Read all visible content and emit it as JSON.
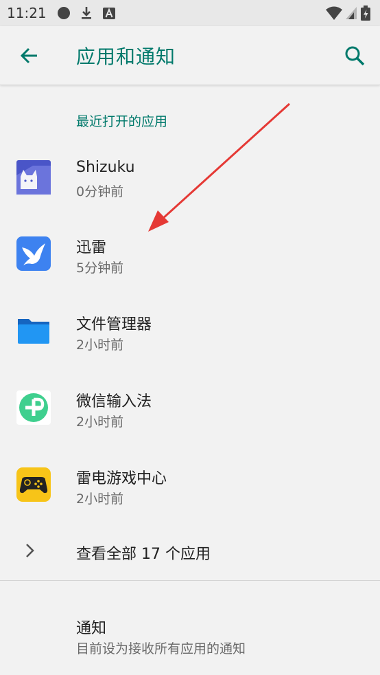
{
  "status_bar": {
    "time": "11:21",
    "icons": [
      "circle-icon",
      "download-icon",
      "font-a-icon",
      "wifi-icon",
      "signal-icon",
      "battery-icon"
    ]
  },
  "app_bar": {
    "title": "应用和通知",
    "back_icon": "arrow-back-icon",
    "search_icon": "search-icon"
  },
  "recent_apps": {
    "header": "最近打开的应用",
    "items": [
      {
        "name": "Shizuku",
        "time": "0分钟前",
        "icon": "shizuku-app-icon"
      },
      {
        "name": "迅雷",
        "time": "5分钟前",
        "icon": "xunlei-app-icon"
      },
      {
        "name": "文件管理器",
        "time": "2小时前",
        "icon": "file-manager-app-icon"
      },
      {
        "name": "微信输入法",
        "time": "2小时前",
        "icon": "wechat-input-app-icon"
      },
      {
        "name": "雷电游戏中心",
        "time": "2小时前",
        "icon": "leidian-game-center-app-icon"
      }
    ]
  },
  "see_all": {
    "label": "查看全部 17 个应用",
    "icon": "chevron-right-icon"
  },
  "notifications": {
    "title": "通知",
    "summary": "目前设为接收所有应用的通知"
  },
  "colors": {
    "accent": "#00796b",
    "annotation_arrow": "#e53935"
  }
}
